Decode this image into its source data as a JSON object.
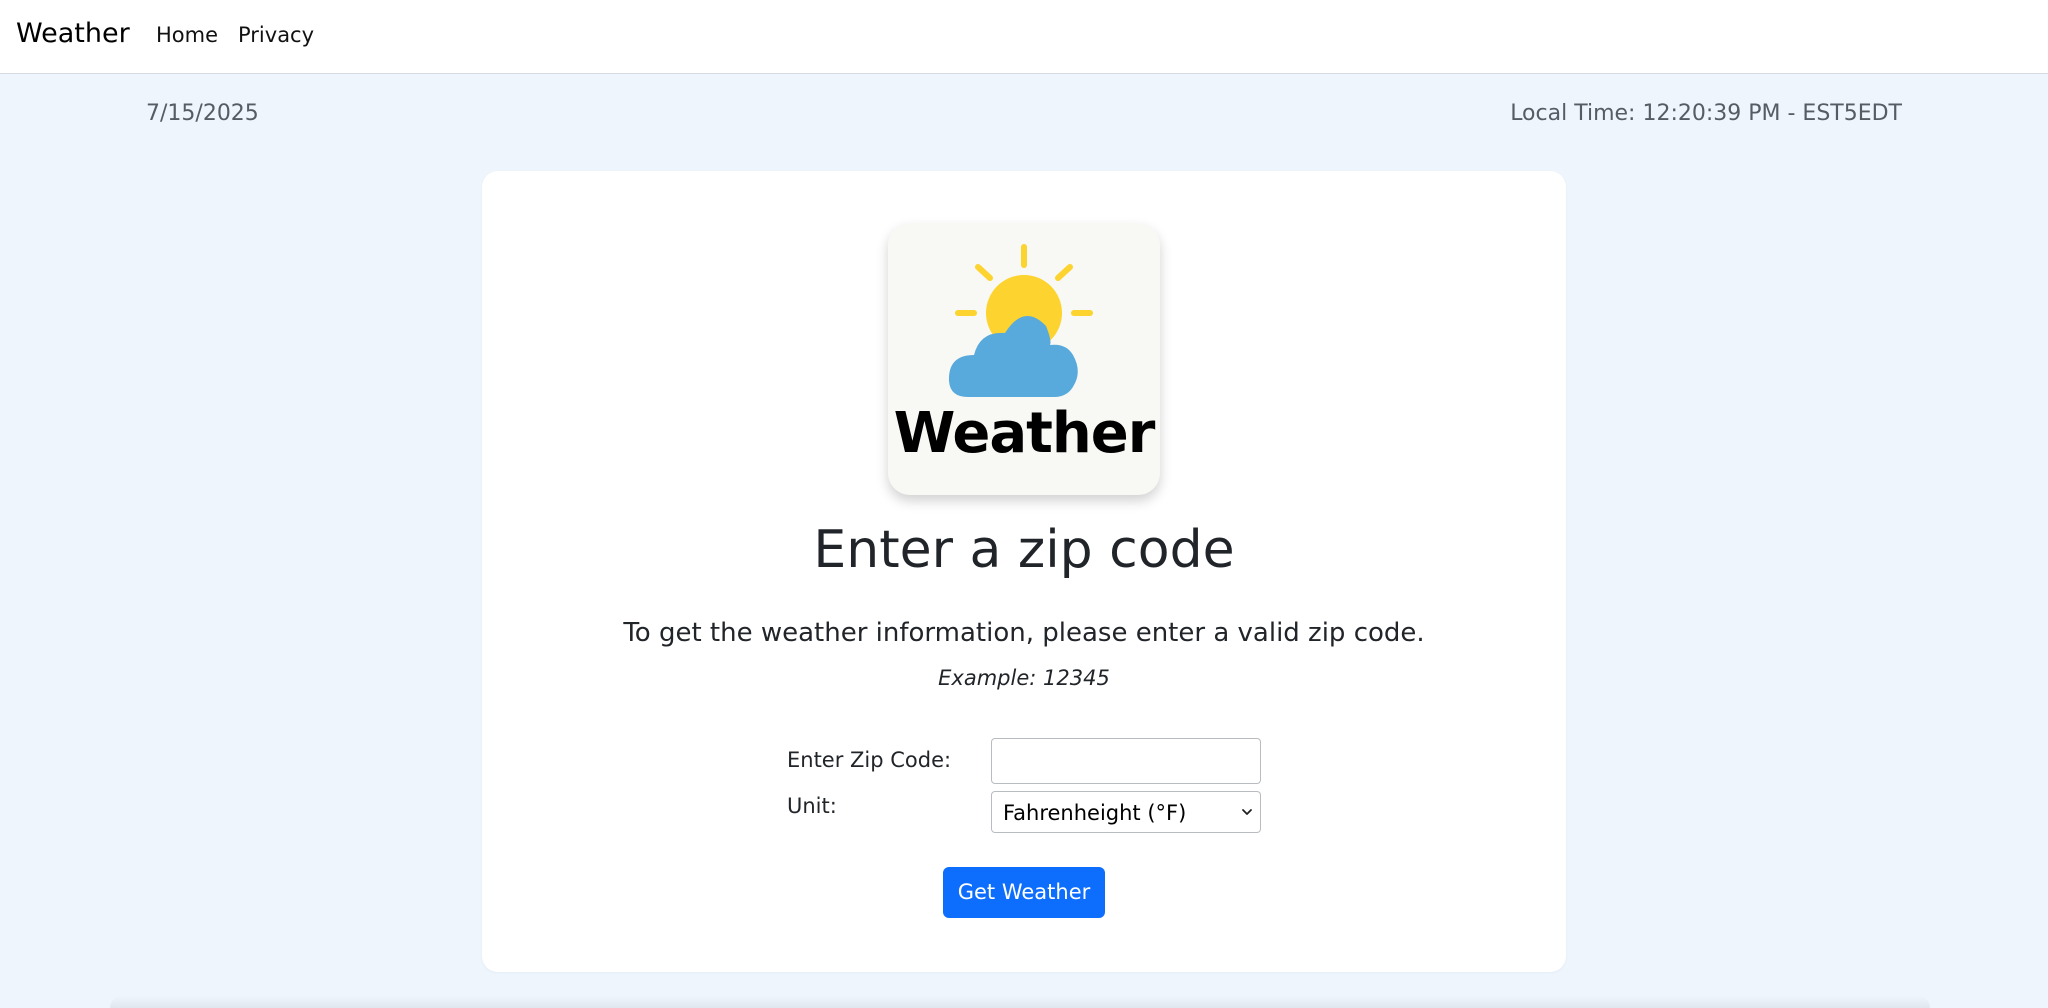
{
  "navbar": {
    "brand": "Weather",
    "links": [
      "Home",
      "Privacy"
    ]
  },
  "info_bar": {
    "date": "7/15/2025",
    "local_time": "Local Time: 12:20:39 PM - EST5EDT"
  },
  "logo": {
    "word": "Weather",
    "icon": "sun-behind-cloud-icon",
    "sun_color": "#fdd32f",
    "cloud_color": "#58aadc"
  },
  "form": {
    "heading": "Enter a zip code",
    "instructions": "To get the weather information, please enter a valid zip code.",
    "example": "Example: 12345",
    "zip_label": "Enter Zip Code:",
    "zip_value": "",
    "unit_label": "Unit:",
    "unit_selected": "Fahrenheight (°F)",
    "submit_label": "Get Weather"
  },
  "colors": {
    "page_background": "#eef5fd",
    "button": "#0d6efd"
  }
}
